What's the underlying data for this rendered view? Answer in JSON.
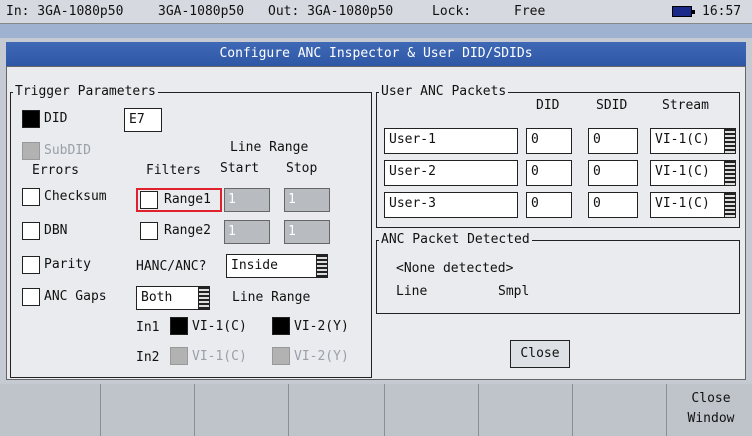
{
  "status": {
    "input": "In: 3GA-1080p50",
    "mid": "3GA-1080p50",
    "output": "Out: 3GA-1080p50",
    "lock_label": "Lock:",
    "lock_value": "Free",
    "time": "16:57"
  },
  "dialog_title": "Configure ANC Inspector & User DID/SDIDs",
  "trigger": {
    "title": "Trigger Parameters",
    "did_label": "DID",
    "did_value": "E7",
    "subdid_label": "SubDID",
    "errors_header": "Errors",
    "filters_header": "Filters",
    "line_range_header": "Line Range",
    "start_header": "Start",
    "stop_header": "Stop",
    "errors": [
      "Checksum",
      "DBN",
      "Parity",
      "ANC Gaps"
    ],
    "range1": {
      "label": "Range1",
      "start": "1",
      "stop": "1"
    },
    "range2": {
      "label": "Range2",
      "start": "1",
      "stop": "1"
    },
    "hanc_label": "HANC/ANC?",
    "hanc_value": "Inside",
    "both_value": "Both",
    "line_range_label": "Line Range",
    "in1_label": "In1",
    "in2_label": "In2",
    "vi1c": "VI-1(C)",
    "vi2y": "VI-2(Y)"
  },
  "user_packets": {
    "title": "User ANC Packets",
    "col_did": "DID",
    "col_sdid": "SDID",
    "col_stream": "Stream",
    "rows": [
      {
        "name": "User-1",
        "did": "0",
        "sdid": "0",
        "stream": "VI-1(C)"
      },
      {
        "name": "User-2",
        "did": "0",
        "sdid": "0",
        "stream": "VI-1(C)"
      },
      {
        "name": "User-3",
        "did": "0",
        "sdid": "0",
        "stream": "VI-1(C)"
      }
    ]
  },
  "detected": {
    "title": "ANC Packet Detected",
    "none": "<None detected>",
    "col_line": "Line",
    "col_smpl": "Smpl"
  },
  "close_button": "Close",
  "softkeys": {
    "close_window": "Close\nWindow"
  }
}
